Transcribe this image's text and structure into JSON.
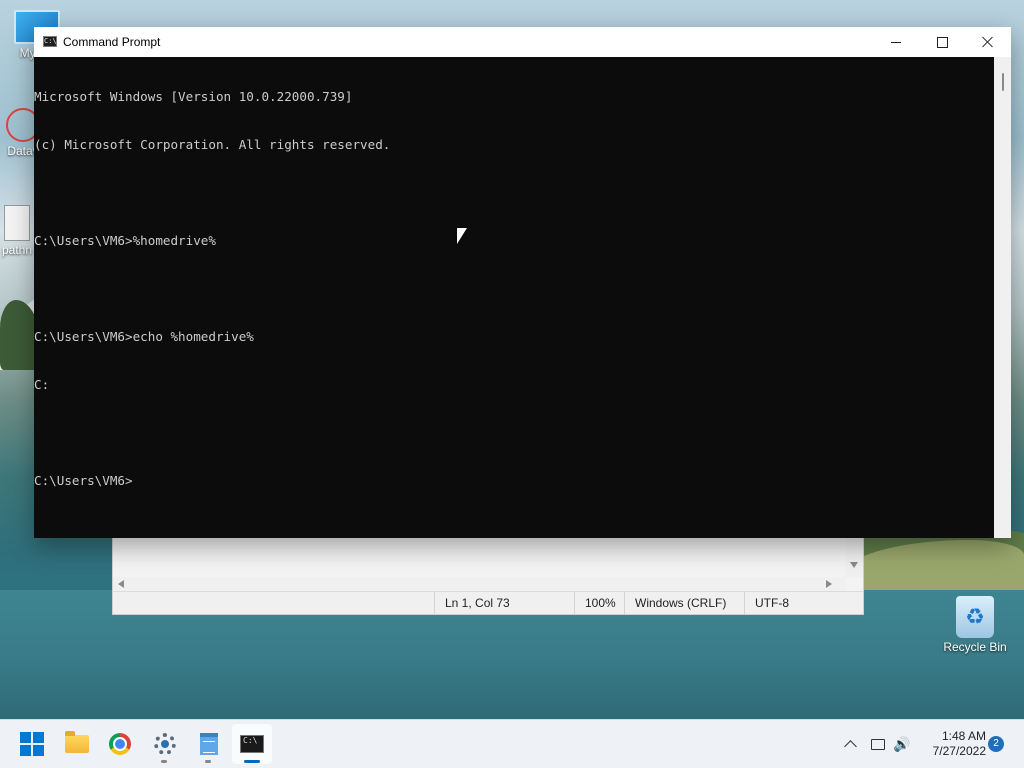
{
  "desktop": {
    "icons": [
      {
        "label": "My Co"
      },
      {
        "label": "Datav"
      },
      {
        "label": "pathn"
      },
      {
        "label": "Recycle Bin"
      }
    ]
  },
  "notepad": {
    "status": {
      "position": "Ln 1, Col 73",
      "zoom": "100%",
      "line_endings": "Windows (CRLF)",
      "encoding": "UTF-8"
    }
  },
  "cmd_window": {
    "title": "Command Prompt",
    "icon_text": "C:\\",
    "lines": [
      "Microsoft Windows [Version 10.0.22000.739]",
      "(c) Microsoft Corporation. All rights reserved.",
      "",
      "C:\\Users\\VM6>%homedrive%",
      "",
      "C:\\Users\\VM6>echo %homedrive%",
      "C:",
      "",
      "C:\\Users\\VM6>"
    ]
  },
  "taskbar": {
    "apps": [
      {
        "name": "start",
        "icon": "windows-logo"
      },
      {
        "name": "file-explorer",
        "icon": "folder-icon"
      },
      {
        "name": "chrome",
        "icon": "chrome-icon"
      },
      {
        "name": "settings",
        "icon": "gear-icon"
      },
      {
        "name": "notepad",
        "icon": "notepad-icon"
      },
      {
        "name": "command-prompt",
        "icon": "terminal-icon",
        "active": true
      }
    ],
    "tray": {
      "time": "1:48 AM",
      "date": "7/27/2022",
      "notification_count": "2",
      "volume_icon": "🔊"
    }
  }
}
